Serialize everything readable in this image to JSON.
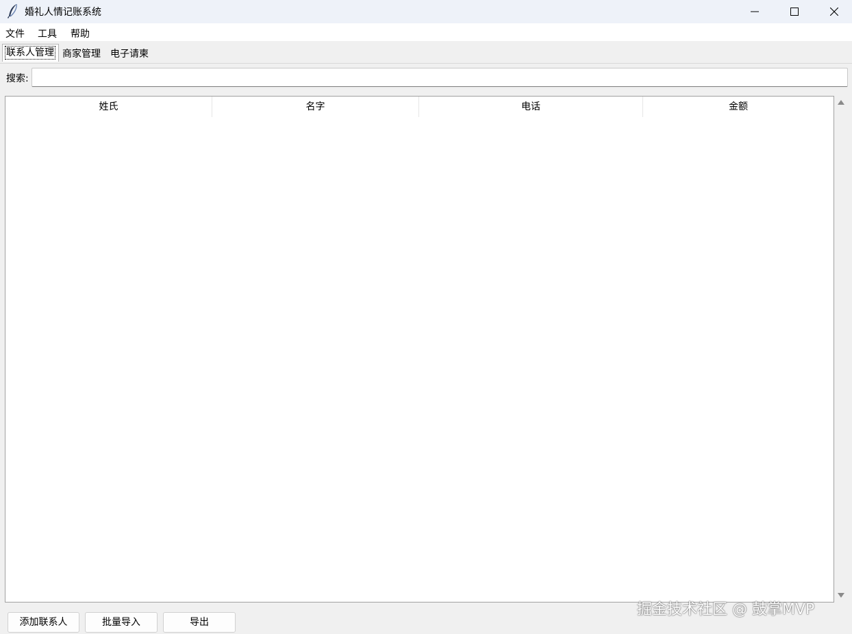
{
  "window": {
    "title": "婚礼人情记账系统"
  },
  "menu": {
    "items": [
      {
        "label": "文件"
      },
      {
        "label": "工具"
      },
      {
        "label": "帮助"
      }
    ]
  },
  "tabs": [
    {
      "label": "联系人管理",
      "active": true
    },
    {
      "label": "商家管理",
      "active": false
    },
    {
      "label": "电子请柬",
      "active": false
    }
  ],
  "search": {
    "label": "搜索:",
    "value": "",
    "placeholder": ""
  },
  "table": {
    "columns": [
      "姓氏",
      "名字",
      "电话",
      "金额"
    ],
    "rows": []
  },
  "buttons": {
    "add_contact": "添加联系人",
    "batch_import": "批量导入",
    "export": "导出"
  },
  "watermark": "掘金技术社区 @ 鼓掌MVP",
  "icons": {
    "app": "feather-icon",
    "minimize": "minimize-icon",
    "maximize": "maximize-icon",
    "close": "close-icon"
  }
}
